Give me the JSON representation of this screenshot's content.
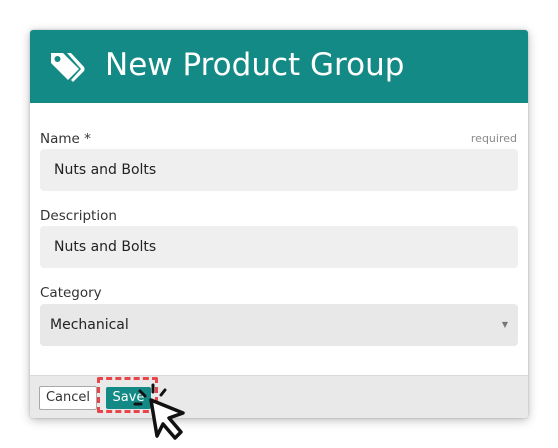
{
  "dialog": {
    "title": "New Product Group",
    "icon": "tag-icon"
  },
  "form": {
    "name": {
      "label": "Name *",
      "hint": "required",
      "value": "Nuts and Bolts"
    },
    "description": {
      "label": "Description",
      "value": "Nuts and Bolts"
    },
    "category": {
      "label": "Category",
      "selected": "Mechanical",
      "arrow_icon": "caret-down-icon"
    }
  },
  "footer": {
    "cancel_label": "Cancel",
    "save_label": "Save"
  },
  "colors": {
    "accent": "#138a85",
    "highlight": "#e8454b"
  }
}
